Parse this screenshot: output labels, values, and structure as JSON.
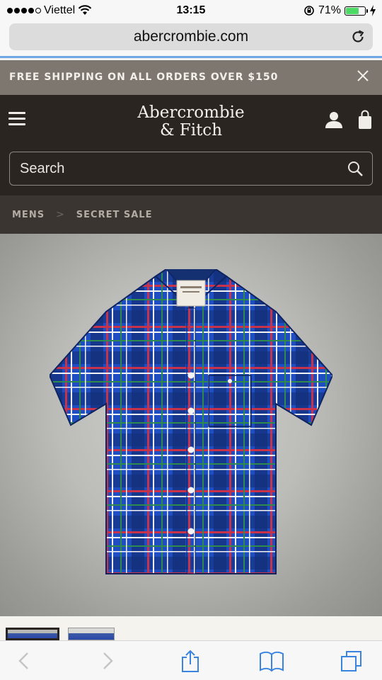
{
  "status_bar": {
    "carrier": "Viettel",
    "time": "13:15",
    "battery_percent": "71%",
    "battery_level": 0.71
  },
  "browser": {
    "url": "abercrombie.com"
  },
  "promo": {
    "text": "FREE SHIPPING ON ALL ORDERS OVER $150"
  },
  "header": {
    "logo_line1": "Abercrombie",
    "logo_line2": "& Fitch",
    "search_placeholder": "Search"
  },
  "breadcrumb": {
    "items": [
      "MENS",
      "SECRET SALE"
    ],
    "separator": ">"
  },
  "product": {
    "image_alt_icon": "plaid-shirt-image",
    "colors": {
      "shirt_base": "#1e4ec1",
      "shirt_dark": "#142e7a",
      "stripe_red": "#c8324a",
      "stripe_white": "#f2f2f2",
      "stripe_green": "#2f8a4e"
    }
  },
  "colors": {
    "header_bg": "#2a2521",
    "promo_bg": "#7d7770",
    "breadcrumb_bg": "#3b3531",
    "accent_blue": "#6fa7e6"
  }
}
